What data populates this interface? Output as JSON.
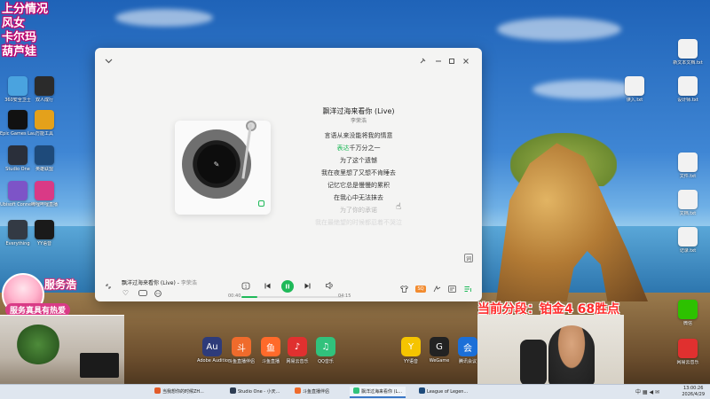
{
  "overlay": {
    "title_lines": [
      "上分情况",
      "风女",
      "卡尔玛",
      "葫芦娃"
    ],
    "service_title": "服务浩",
    "service_sub": "服务真具有热爱",
    "rank_text": "当前分段：铂金4 68胜点"
  },
  "desktop_icons": [
    {
      "label": "360安全卫士",
      "color": "#4aa3df"
    },
    {
      "label": "双人成行",
      "color": "#2b2b2b"
    },
    {
      "label": "Epic Games Launcher",
      "color": "#111111"
    },
    {
      "label": "万能工具",
      "color": "#e4a11b"
    },
    {
      "label": "Studio One",
      "color": "#2a2f3a"
    },
    {
      "label": "英雄联盟",
      "color": "#1e4a7a"
    },
    {
      "label": "Ubisoft Connect",
      "color": "#7d54c7"
    },
    {
      "label": "哔哩哔哩直播",
      "color": "#d93a86"
    },
    {
      "label": "Everything",
      "color": "#333a44"
    },
    {
      "label": "YY语音",
      "color": "#1a1a1a"
    }
  ],
  "right_icons": [
    {
      "label": "新文本文档.txt"
    },
    {
      "label": "读入.txt"
    },
    {
      "label": "设计师.txt"
    },
    {
      "label": "文件.txt"
    },
    {
      "label": "文档.txt"
    },
    {
      "label": "记录.txt"
    },
    {
      "label": "微信"
    },
    {
      "label": "网易云音乐"
    }
  ],
  "player": {
    "song_title": "飘洋过海来看你 (Live)",
    "artist": "李荣浩",
    "lyrics": [
      {
        "text": "言语从来没能将我的情意",
        "state": "normal"
      },
      {
        "text_hl": "表达",
        "text": "千万分之一",
        "state": "current"
      },
      {
        "text": "为了这个遗憾",
        "state": "normal"
      },
      {
        "text": "我在夜里想了又想不肯睡去",
        "state": "normal"
      },
      {
        "text": "记忆它总是慢慢的累积",
        "state": "normal"
      },
      {
        "text": "在我心中无法抹去",
        "state": "normal"
      },
      {
        "text": "为了你的承诺",
        "state": "dim"
      },
      {
        "text": "我在最绝望的时候都忍着不哭泣",
        "state": "faint"
      }
    ],
    "mini_title": "飘洋过海来看你 (Live)",
    "mini_artist": "李荣浩",
    "time_current": "00:40",
    "time_total": "04:15",
    "progress": 0.16,
    "quality_badge": "SQ",
    "accent": "#1fb959"
  },
  "dock": [
    {
      "label": "Adobe Audition",
      "color": "#2e3b7a",
      "glyph": "Au"
    },
    {
      "label": "斗鱼直播伴侣",
      "color": "#ef6b2c",
      "glyph": "斗"
    },
    {
      "label": "斗鱼直播",
      "color": "#ff6a2a",
      "glyph": "鱼"
    },
    {
      "label": "网易云音乐",
      "color": "#e0302f",
      "glyph": "♪"
    },
    {
      "label": "QQ音乐",
      "color": "#31c27c",
      "glyph": "♫"
    },
    {
      "label": "YY语音",
      "color": "#f5c400",
      "glyph": "Y"
    },
    {
      "label": "WeGame",
      "color": "#222222",
      "glyph": "G"
    },
    {
      "label": "腾讯会议",
      "color": "#1b6fd8",
      "glyph": "会"
    }
  ],
  "taskbar": {
    "items": [
      {
        "label": "当我想你的时候ZH...",
        "color": "#e25b2a",
        "active": false
      },
      {
        "label": "Studio One - 小天...",
        "color": "#2d3c52",
        "active": false
      },
      {
        "label": "斗鱼直播伴侣",
        "color": "#ef6b2c",
        "active": false
      },
      {
        "label": "飘洋过海来看你 (L...",
        "color": "#31c27c",
        "active": true
      },
      {
        "label": "League of Legen...",
        "color": "#1e4a7a",
        "active": false
      }
    ],
    "tray": "中 ▦ ◀ ✉",
    "time": "13:00:26",
    "date": "2026/4/29"
  }
}
